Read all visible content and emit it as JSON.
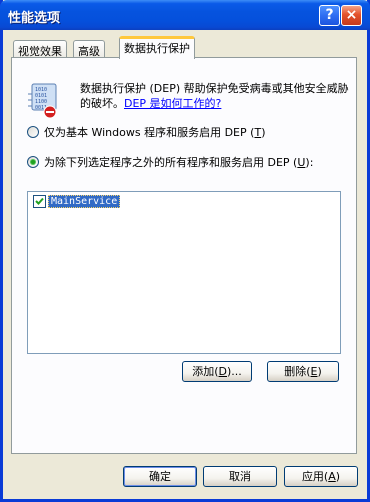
{
  "window": {
    "title": "性能选项",
    "help_glyph": "?",
    "close_glyph": "×"
  },
  "tabs": [
    {
      "label": "视觉效果",
      "active": false
    },
    {
      "label": "高级",
      "active": false
    },
    {
      "label": "数据执行保护",
      "active": true
    }
  ],
  "dep": {
    "icon": "dep-shield-icon",
    "description": "数据执行保护 (DEP) 帮助保护免受病毒或其他安全威胁的破坏。",
    "link_text": "DEP 是如何工作的?",
    "option_essential": {
      "label_pre": "仅为基本 Windows 程序和服务启用 DEP ",
      "mnemonic": "T",
      "label_post": "",
      "selected": false
    },
    "option_all": {
      "label_pre": "为除下列选定程序之外的所有程序和服务启用 DEP ",
      "mnemonic": "U",
      "label_post": ":",
      "selected": true
    },
    "program_list": [
      {
        "name": "MainService",
        "checked": true
      }
    ],
    "add_button": {
      "pre": "添加(",
      "mnemonic": "D",
      "post": ")..."
    },
    "remove_button": {
      "pre": "删除(",
      "mnemonic": "E",
      "post": ")"
    }
  },
  "footer": {
    "ok": "确定",
    "cancel": "取消",
    "apply_pre": "应用(",
    "apply_mnemonic": "A",
    "apply_post": ")"
  },
  "colors": {
    "titlebar": "#0653de",
    "window_bg": "#ece9d8",
    "selection": "#316ac5",
    "link": "#0000ff"
  }
}
